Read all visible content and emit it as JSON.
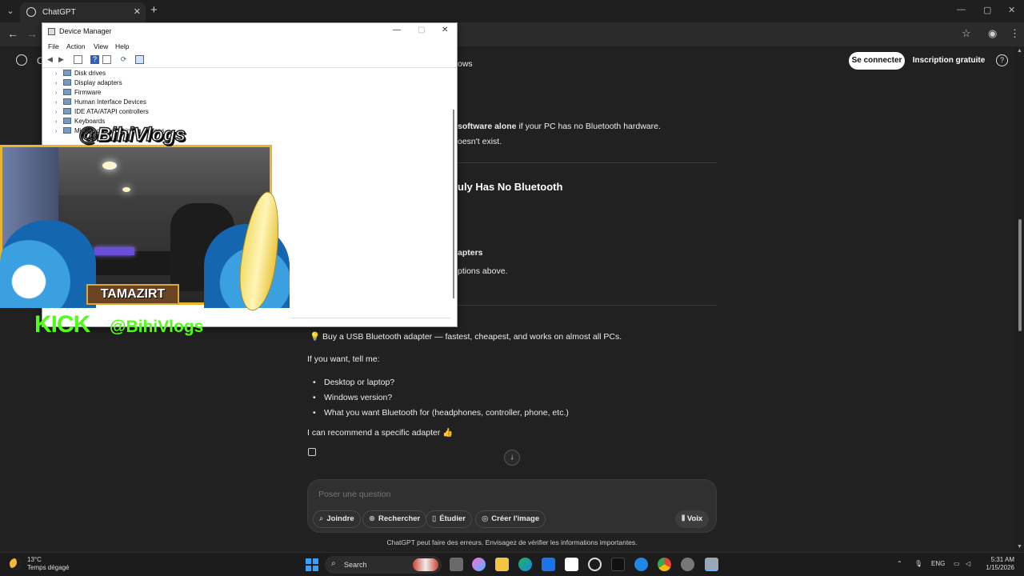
{
  "browser": {
    "tab_title": "ChatGPT",
    "tab_close": "✕",
    "new_tab": "+"
  },
  "chatgpt": {
    "logo_letter": "C",
    "login": "Se connecter",
    "signup": "Inscription gratuite",
    "help": "?",
    "fragments": {
      "f1": "ows",
      "f2_bold": "software alone",
      "f2_rest": " if your PC has no Bluetooth hardware.",
      "f3": "oesn't exist.",
      "h_no_bt": "uly Has No Bluetooth",
      "f4_bold": "apters",
      "f5": "ptions above."
    },
    "tip_icon": "💡",
    "tip_bold": "Buy a USB Bluetooth adapter",
    "tip_rest": " — fastest, cheapest, and works on almost all PCs.",
    "ask_intro": "If you want, tell me:",
    "questions": [
      "Desktop or laptop?",
      "Windows version?",
      "What you want Bluetooth for (headphones, controller, phone, etc.)"
    ],
    "recommend": "I can recommend a specific adapter 👍",
    "composer_placeholder": "Poser une question",
    "pills": {
      "attach": "Joindre",
      "search": "Rechercher",
      "study": "Étudier",
      "image": "Créer l'image",
      "voice": "Voix"
    },
    "disclaimer": "ChatGPT peut faire des erreurs. Envisagez de vérifier les informations importantes."
  },
  "device_manager": {
    "title": "Device Manager",
    "menu": [
      "File",
      "Action",
      "View",
      "Help"
    ],
    "tree": [
      "Disk drives",
      "Display adapters",
      "Firmware",
      "Human Interface Devices",
      "IDE ATA/ATAPI controllers",
      "Keyboards",
      "Mice and other pointing devices"
    ]
  },
  "overlay": {
    "handle": "@BihiVlogs",
    "banner": "TAMAZIRT",
    "kick_logo": "KICK",
    "kick_handle": "@BihiVlogs"
  },
  "taskbar": {
    "temperature": "13°C",
    "condition": "Temps dégagé",
    "search_label": "Search",
    "language": "ENG",
    "time": "5:31 AM",
    "date": "1/15/2026"
  },
  "colors": {
    "page_bg": "#212121",
    "composer_bg": "#303030",
    "kick_green": "#53fc18",
    "overlay_gold": "#e7b52e"
  }
}
